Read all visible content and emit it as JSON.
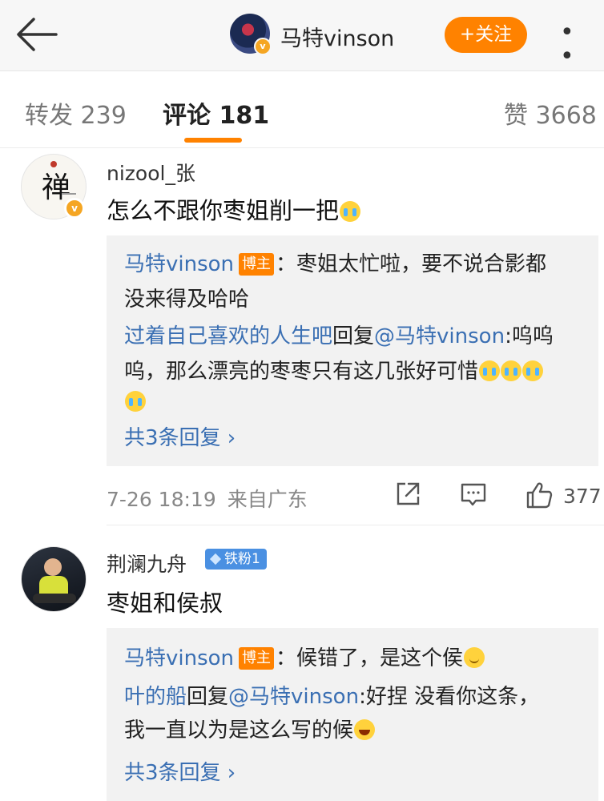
{
  "header": {
    "user_name": "马特vinson",
    "follow_label": "+关注",
    "more_label": "• • •"
  },
  "tabs": [
    {
      "label": "转发 239"
    },
    {
      "label": "评论 181"
    },
    {
      "label": "赞 3668"
    }
  ],
  "comments": [
    {
      "user": "nizool_张",
      "text": "怎么不跟你枣姐削一把",
      "replies": [
        {
          "author": "马特vinson",
          "author_tag": "博主",
          "line1": "：枣姐太忙啦，要不说合影都",
          "line2": "没来得及哈哈"
        },
        {
          "author": "过着自己喜欢的人生吧",
          "verb": "回复",
          "mention": "@马特vinson",
          "line1": ":呜呜",
          "line2": "呜，那么漂亮的枣枣只有这几张好可惜"
        }
      ],
      "more_replies": "共3条回复 ›",
      "time": "7-26 18:19",
      "location": "来自广东",
      "like_count": "377"
    },
    {
      "user": "荆澜九舟",
      "fan_badge": "铁粉1",
      "text": "枣姐和侯叔",
      "replies": [
        {
          "author": "马特vinson",
          "author_tag": "博主",
          "line1": "：候错了，是这个侯"
        },
        {
          "author": "叶的船",
          "verb": "回复",
          "mention": "@马特vinson",
          "line1": ":好捏 没看你这条，",
          "line2": "我一直以为是这么写的候"
        }
      ],
      "more_replies": "共3条回复 ›"
    }
  ],
  "icons": {
    "back": "back-arrow-icon",
    "verified": "verified-badge-icon",
    "share": "share-icon",
    "comment": "comment-icon",
    "like": "like-icon",
    "emoji_cry": "crying-emoji-icon",
    "emoji_smile": "smile-emoji-icon",
    "emoji_laugh": "laugh-emoji-icon"
  },
  "colors": {
    "accent": "#ff8200",
    "link": "#3a6fb3",
    "fan_badge": "#4a90e2"
  }
}
